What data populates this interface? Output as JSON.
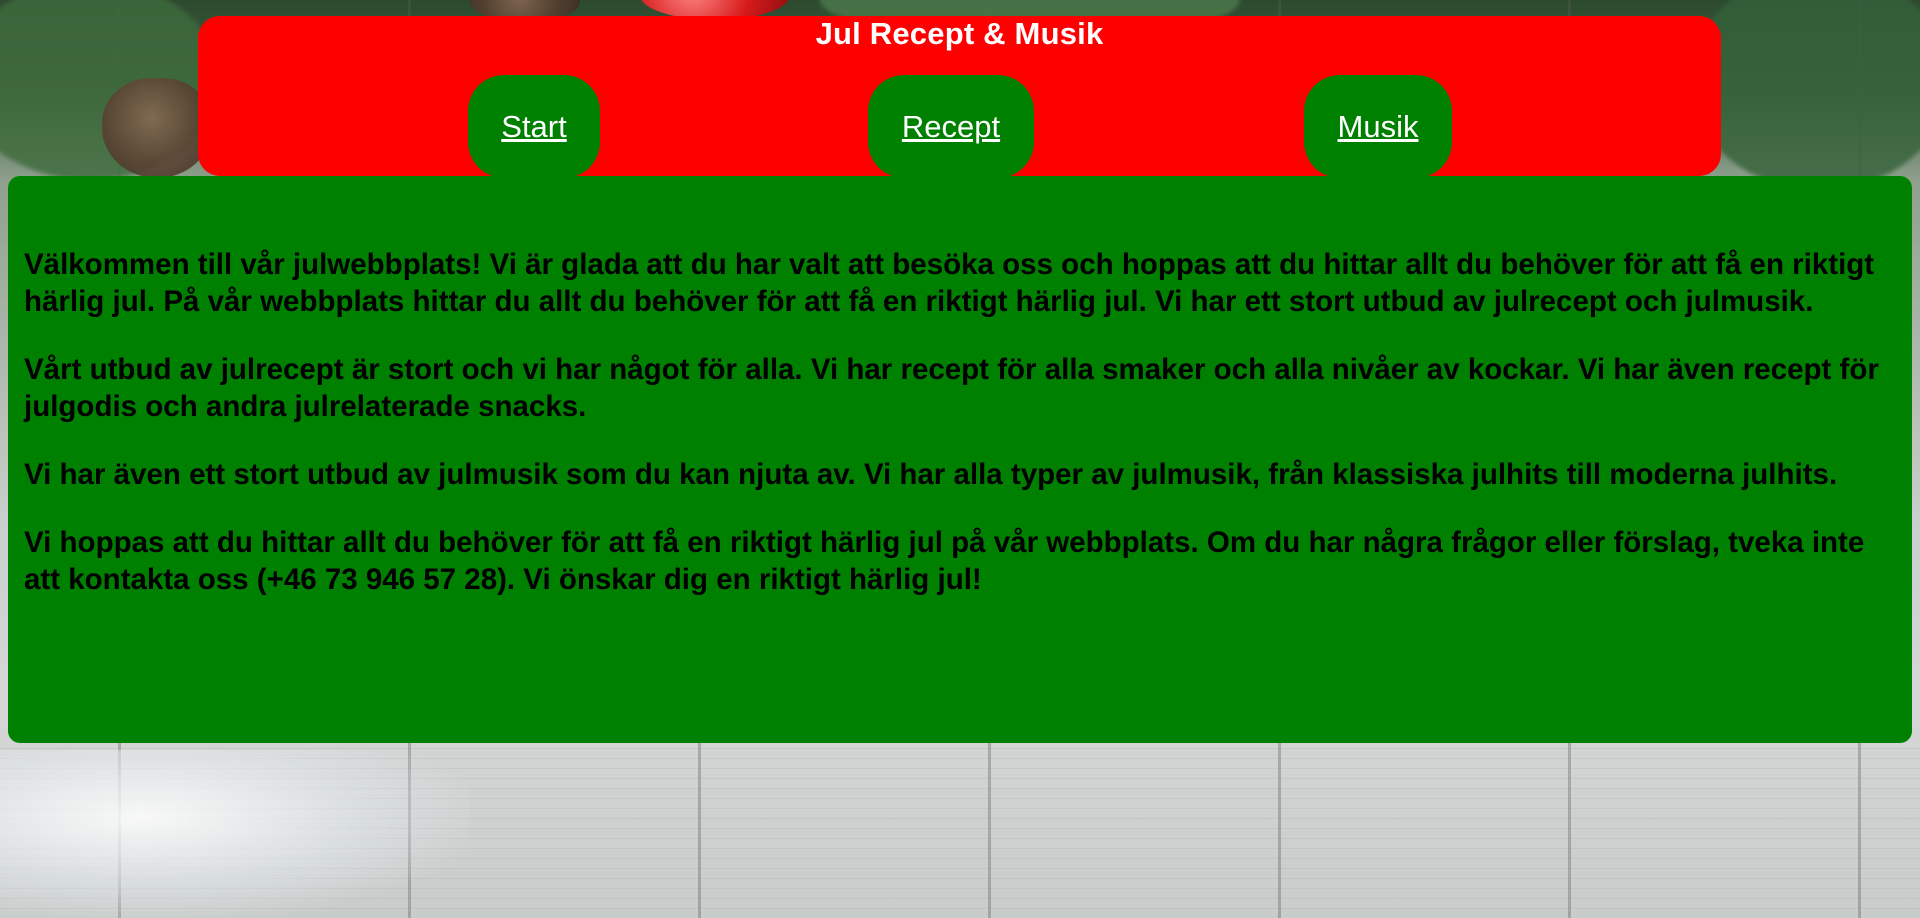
{
  "header": {
    "title": "Jul Recept & Musik",
    "background_color": "#ff0000"
  },
  "nav": {
    "items": [
      {
        "label": "Start"
      },
      {
        "label": "Recept"
      },
      {
        "label": "Musik"
      }
    ],
    "button_color": "#008000",
    "text_color": "#ffffff"
  },
  "main": {
    "background_color": "#008000",
    "paragraphs": [
      "Välkommen till vår julwebbplats! Vi är glada att du har valt att besöka oss och hoppas att du hittar allt du behöver för att få en riktigt härlig jul. På vår webbplats hittar du allt du behöver för att få en riktigt härlig jul. Vi har ett stort utbud av julrecept och julmusik.",
      "Vårt utbud av julrecept är stort och vi har något för alla. Vi har recept för alla smaker och alla nivåer av kockar. Vi har även recept för julgodis och andra julrelaterade snacks.",
      "Vi har även ett stort utbud av julmusik som du kan njuta av. Vi har alla typer av julmusik, från klassiska julhits till moderna julhits.",
      "Vi hoppas att du hittar allt du behöver för att få en riktigt härlig jul på vår webbplats. Om du har några frågor eller förslag, tveka inte att kontakta oss (+46 73 946 57 28). Vi önskar dig en riktigt härlig jul!"
    ]
  }
}
